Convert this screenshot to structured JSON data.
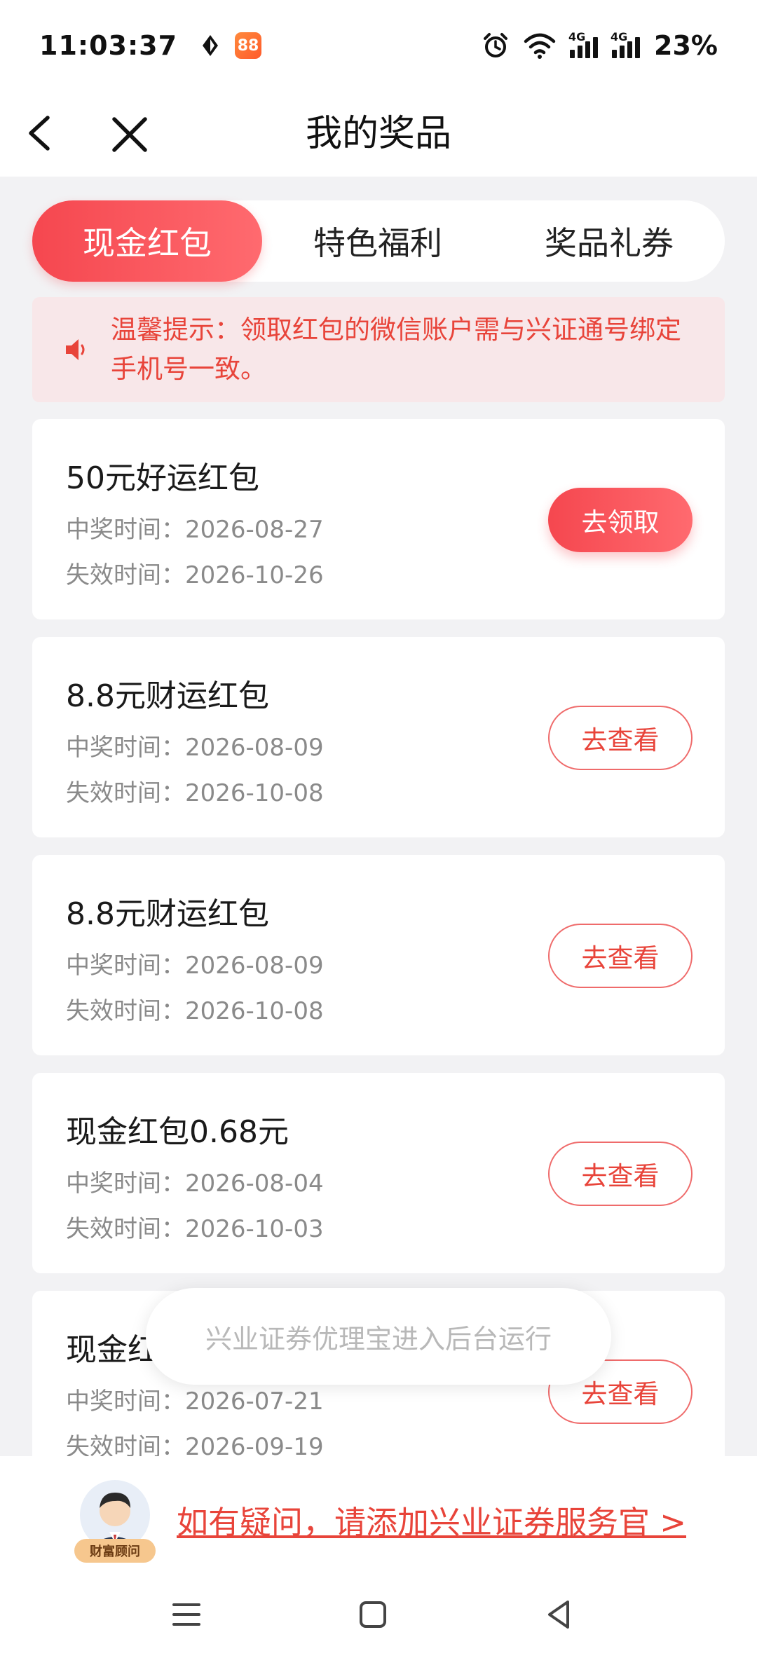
{
  "status_bar": {
    "time": "11:03:37",
    "battery": "23%",
    "network_1": "4G",
    "network_2": "4G",
    "app_badge": "88"
  },
  "nav": {
    "title": "我的奖品"
  },
  "tabs": [
    {
      "label": "现金红包",
      "active": true
    },
    {
      "label": "特色福利",
      "active": false
    },
    {
      "label": "奖品礼券",
      "active": false
    }
  ],
  "notice": {
    "text": "温馨提示：领取红包的微信账户需与兴证通号绑定手机号一致。"
  },
  "prizes": [
    {
      "title": "50元好运红包",
      "win_time": "中奖时间：2026-08-27",
      "expire_time": "失效时间：2026-10-26",
      "button": "去领取",
      "button_style": "primary"
    },
    {
      "title": "8.8元财运红包",
      "win_time": "中奖时间：2026-08-09",
      "expire_time": "失效时间：2026-10-08",
      "button": "去查看",
      "button_style": "outline"
    },
    {
      "title": "8.8元财运红包",
      "win_time": "中奖时间：2026-08-09",
      "expire_time": "失效时间：2026-10-08",
      "button": "去查看",
      "button_style": "outline"
    },
    {
      "title": "现金红包0.68元",
      "win_time": "中奖时间：2026-08-04",
      "expire_time": "失效时间：2026-10-03",
      "button": "去查看",
      "button_style": "outline"
    },
    {
      "title": "现金红",
      "win_time": "中奖时间：2026-07-21",
      "expire_time": "失效时间：2026-09-19",
      "button": "去查看",
      "button_style": "outline"
    }
  ],
  "toast": {
    "text": "兴业证券优理宝进入后台运行"
  },
  "footer": {
    "advisor_badge": "财富顾问",
    "help_link": "如有疑问，请添加兴业证券服务官 >"
  },
  "colors": {
    "accent": "#f5474f",
    "accent_text": "#e8443a",
    "notice_bg": "#f8e7e9",
    "page_bg": "#f2f2f4"
  }
}
